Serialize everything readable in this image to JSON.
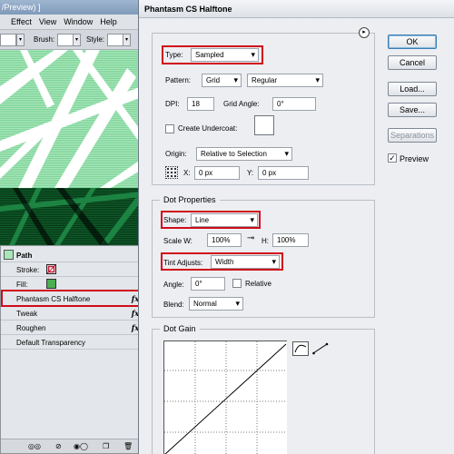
{
  "background_app": {
    "title_fragment": "/Preview) ]",
    "menu": [
      "Effect",
      "View",
      "Window",
      "Help"
    ],
    "toolbar": {
      "brush_label": "Brush:",
      "style_label": "Style:"
    }
  },
  "appearance_panel": {
    "target": "Path",
    "stroke_label": "Stroke:",
    "fill_label": "Fill:",
    "effects": [
      {
        "label": "Phantasm CS Halftone",
        "fx": "fx"
      },
      {
        "label": "Tweak",
        "fx": "fx"
      },
      {
        "label": "Roughen",
        "fx": "fx"
      }
    ],
    "default_transparency": "Default Transparency",
    "colors": {
      "fill": "#4caf50",
      "stroke": "#c0213a"
    }
  },
  "dialog": {
    "title": "Phantasm CS Halftone",
    "type": {
      "label": "Type:",
      "value": "Sampled"
    },
    "pattern": {
      "label": "Pattern:",
      "value": "Grid",
      "value2": "Regular"
    },
    "dpi": {
      "label": "DPI:",
      "value": "18"
    },
    "grid_angle": {
      "label": "Grid Angle:",
      "value": "0°"
    },
    "create_undercoat": "Create Undercoat:",
    "origin": {
      "label": "Origin:",
      "value": "Relative to Selection"
    },
    "x": {
      "label": "X:",
      "value": "0 px"
    },
    "y": {
      "label": "Y:",
      "value": "0 px"
    },
    "dot_properties": {
      "title": "Dot Properties",
      "shape": {
        "label": "Shape:",
        "value": "Line"
      },
      "scale_w": {
        "label": "Scale W:",
        "value": "100%"
      },
      "scale_h": {
        "label": "H:",
        "value": "100%"
      },
      "tint_adjusts": {
        "label": "Tint Adjusts:",
        "value": "Width"
      },
      "angle": {
        "label": "Angle:",
        "value": "0°"
      },
      "relative": "Relative",
      "blend": {
        "label": "Blend:",
        "value": "Normal"
      }
    },
    "dot_gain": {
      "title": "Dot Gain"
    },
    "buttons": {
      "ok": "OK",
      "cancel": "Cancel",
      "load": "Load...",
      "save": "Save...",
      "separations": "Separations"
    },
    "preview": {
      "label": "Preview",
      "checked": true
    },
    "highlight_color": "#d10b19"
  }
}
